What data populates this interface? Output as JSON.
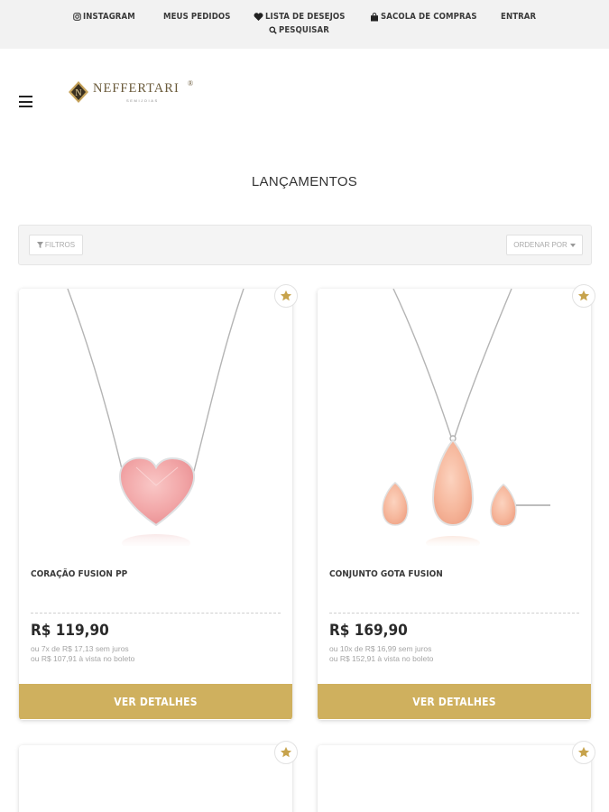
{
  "topbar": {
    "instagram": "INSTAGRAM",
    "orders": "MEUS PEDIDOS",
    "wishlist": "LISTA DE DESEJOS",
    "bag": "SACOLA DE COMPRAS",
    "login": "ENTRAR",
    "search": "PESQUISAR"
  },
  "brand": {
    "name": "NEFFERTARI",
    "mark": "N",
    "registered": "®",
    "tagline": "SEMIJOIAS"
  },
  "page": {
    "title": "LANÇAMENTOS"
  },
  "toolbar": {
    "filters": "FILTROS",
    "sort": "ORDENAR POR"
  },
  "products": [
    {
      "name": "CORAÇÃO FUSION PP",
      "price": "R$ 119,90",
      "installments": "ou 7x de R$ 17,13 sem juros",
      "cash": "ou R$ 107,91 à vista no boleto",
      "button": "VER DETALHES"
    },
    {
      "name": "CONJUNTO GOTA FUSION",
      "price": "R$ 169,90",
      "installments": "ou 10x de R$ 16,99 sem juros",
      "cash": "ou R$ 152,91 à vista no boleto",
      "button": "VER DETALHES"
    }
  ],
  "colors": {
    "accent": "#cfb05e",
    "topbar_bg": "#f2f2f2",
    "text_dark": "#333333",
    "muted": "#a5a5a5"
  }
}
